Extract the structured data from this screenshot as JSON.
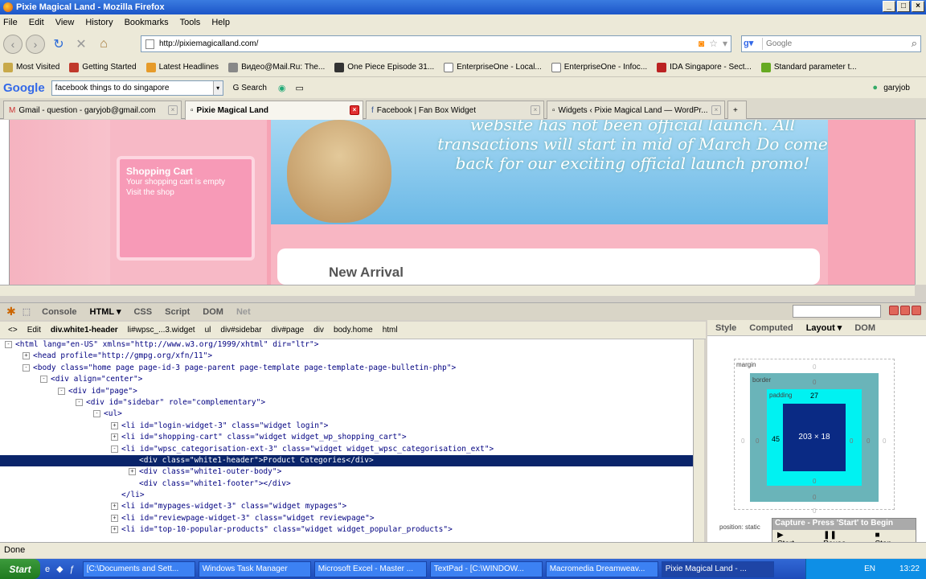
{
  "window": {
    "title": "Pixie Magical Land - Mozilla Firefox"
  },
  "menu": [
    "File",
    "Edit",
    "View",
    "History",
    "Bookmarks",
    "Tools",
    "Help"
  ],
  "url": "http://pixiemagicalland.com/",
  "search_placeholder": "Google",
  "bookmarks": [
    "Most Visited",
    "Getting Started",
    "Latest Headlines",
    "Видео@Mail.Ru: The...",
    "One Piece Episode 31...",
    "EnterpriseOne - Local...",
    "EnterpriseOne - Infoc...",
    "IDA Singapore - Sect...",
    "Standard parameter t..."
  ],
  "google_toolbar": {
    "logo": "Google",
    "query": "facebook things to do singapore",
    "search_label": "Search",
    "user": "garyjob"
  },
  "tabs": [
    {
      "label": "Gmail - question - garyjob@gmail.com"
    },
    {
      "label": "Pixie Magical Land"
    },
    {
      "label": "Facebook | Fan Box Widget"
    },
    {
      "label": "Widgets ‹ Pixie Magical Land — WordPr..."
    }
  ],
  "page": {
    "banner_text": "website has not been official launch. All transactions will start in mid of March Do come back for our exciting official launch promo!",
    "cart_title": "Shopping Cart",
    "cart_line1": "Your shopping cart is empty",
    "cart_line2": "Visit the shop",
    "news_heading": "New Arrival"
  },
  "firebug": {
    "tabs": [
      "Console",
      "HTML ▾",
      "CSS",
      "Script",
      "DOM",
      "Net"
    ],
    "edit_label": "Edit",
    "crumbs": [
      "div.white1-header",
      "li#wpsc_...3.widget",
      "ul",
      "div#sidebar",
      "div#page",
      "div",
      "body.home",
      "html"
    ],
    "side_tabs": [
      "Style",
      "Computed",
      "Layout ▾",
      "DOM"
    ],
    "tree": [
      {
        "pm": "-",
        "indent": 0,
        "t": "<html lang=\"en-US\" xmlns=\"http://www.w3.org/1999/xhtml\" dir=\"ltr\">"
      },
      {
        "pm": "+",
        "indent": 1,
        "t": "<head profile=\"http://gmpg.org/xfn/11\">"
      },
      {
        "pm": "-",
        "indent": 1,
        "t": "<body class=\"home page page-id-3 page-parent page-template page-template-page-bulletin-php\">"
      },
      {
        "pm": "-",
        "indent": 2,
        "t": "<div align=\"center\">"
      },
      {
        "pm": "-",
        "indent": 3,
        "t": "<div id=\"page\">"
      },
      {
        "pm": "-",
        "indent": 4,
        "t": "<div id=\"sidebar\" role=\"complementary\">"
      },
      {
        "pm": "-",
        "indent": 5,
        "t": "<ul>"
      },
      {
        "pm": "+",
        "indent": 6,
        "t": "<li id=\"login-widget-3\" class=\"widget login\">"
      },
      {
        "pm": "+",
        "indent": 6,
        "t": "<li id=\"shopping-cart\" class=\"widget widget_wp_shopping_cart\">"
      },
      {
        "pm": "-",
        "indent": 6,
        "t": "<li id=\"wpsc_categorisation-ext-3\" class=\"widget widget_wpsc_categorisation_ext\">"
      },
      {
        "pm": "",
        "indent": 7,
        "t": "<div class=\"white1-header\">Product Categories</div>",
        "sel": true
      },
      {
        "pm": "+",
        "indent": 7,
        "t": "<div class=\"white1-outer-body\">"
      },
      {
        "pm": "",
        "indent": 7,
        "t": "<div class=\"white1-footer\"></div>"
      },
      {
        "pm": "",
        "indent": 6,
        "t": "</li>"
      },
      {
        "pm": "+",
        "indent": 6,
        "t": "<li id=\"mypages-widget-3\" class=\"widget mypages\">"
      },
      {
        "pm": "+",
        "indent": 6,
        "t": "<li id=\"reviewpage-widget-3\" class=\"widget reviewpage\">"
      },
      {
        "pm": "+",
        "indent": 6,
        "t": "<li id=\"top-10-popular-products\" class=\"widget widget_popular_products\">"
      }
    ],
    "layout": {
      "margin_label": "margin",
      "border_label": "border",
      "padding_label": "padding",
      "padding_top": "27",
      "padding_left": "45",
      "content": "203 × 18",
      "zero": "0",
      "position": "position: static"
    }
  },
  "capture": {
    "title": "Capture - Press 'Start' to Begin",
    "start": "Start",
    "pause": "Pause",
    "stop": "Stop"
  },
  "status": "Done",
  "taskbar": {
    "start": "Start",
    "items": [
      "[C:\\Documents and Sett...",
      "Windows Task Manager",
      "Microsoft Excel - Master ...",
      "TextPad - [C:\\WINDOW...",
      "Macromedia Dreamweav...",
      "Pixie Magical Land - ..."
    ],
    "lang": "EN",
    "time": "13:22"
  }
}
